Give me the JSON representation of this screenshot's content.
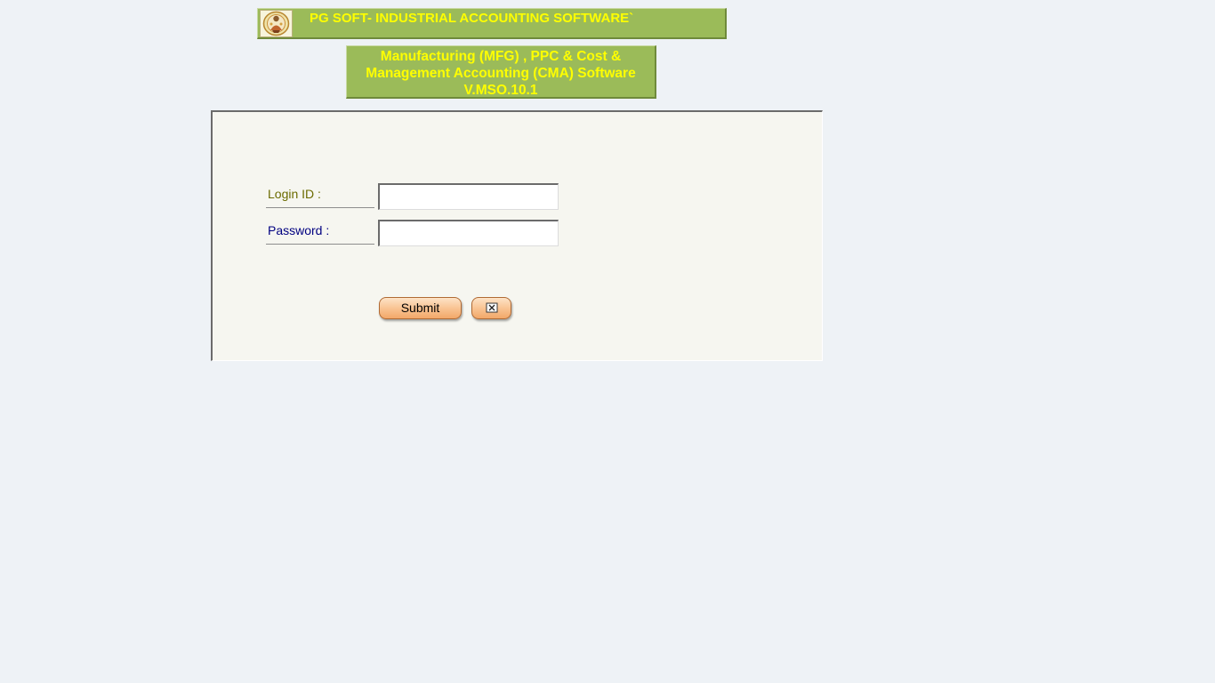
{
  "header": {
    "title": "PG SOFT- INDUSTRIAL ACCOUNTING SOFTWARE`",
    "logo_icon": "deity-logo-icon"
  },
  "subheader": {
    "line1": "Manufacturing (MFG) , PPC & Cost &",
    "line2": "Management Accounting (CMA) Software",
    "line3": "V.MSO.10.1"
  },
  "login": {
    "login_id_label": "Login ID  :",
    "login_id_value": "",
    "password_label": "Password :",
    "password_value": "",
    "submit_label": "Submit",
    "close_icon": "close-window-icon"
  },
  "colors": {
    "banner_bg": "#9bbb59",
    "banner_text": "#ffff00",
    "panel_bg": "#f6f6f0",
    "page_bg": "#eef2f6",
    "button_orange": "#f9c494"
  }
}
